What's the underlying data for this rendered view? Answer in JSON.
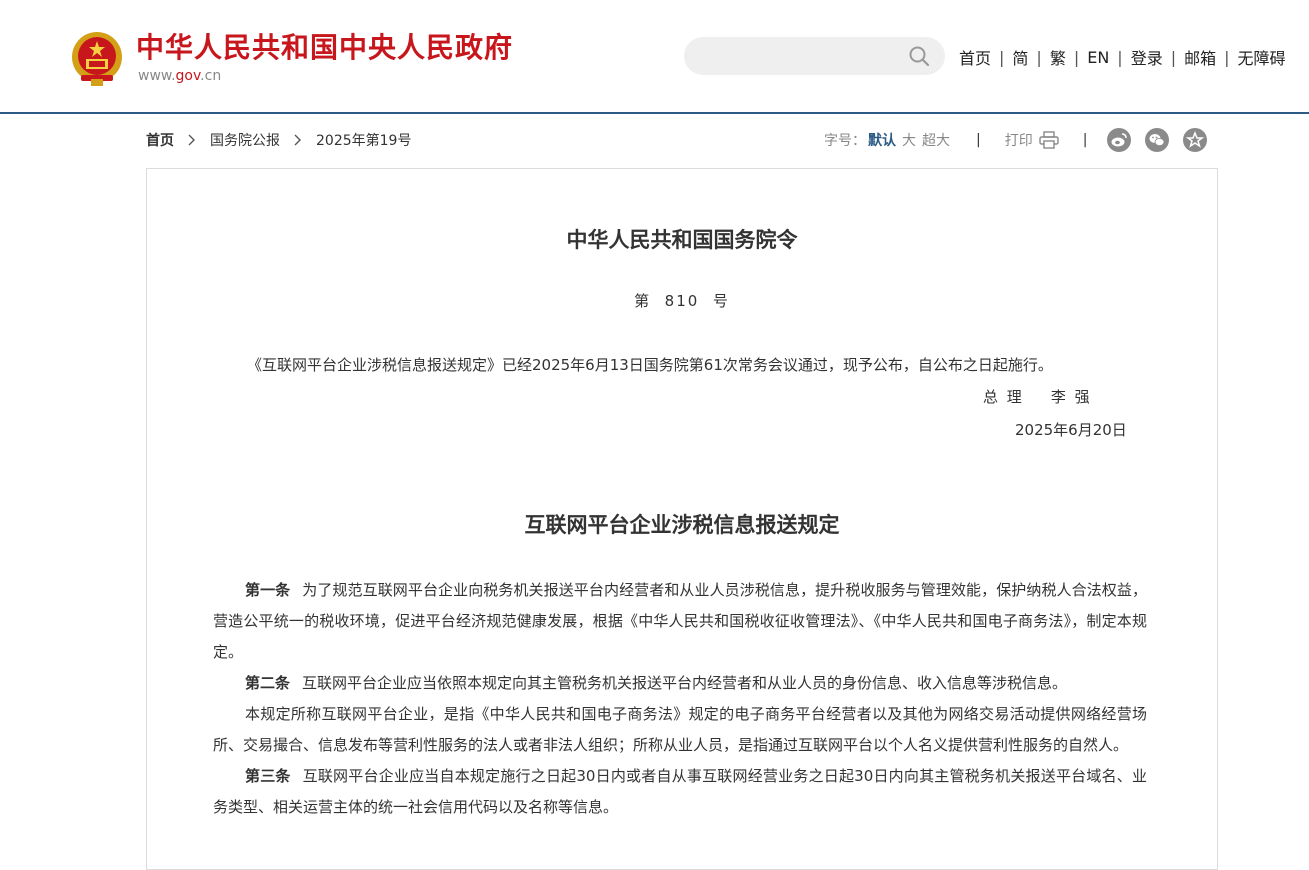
{
  "header": {
    "site_title": "中华人民共和国中央人民政府",
    "domain_prefix": "www.",
    "domain_highlight": "gov",
    "domain_suffix": ".cn",
    "search": {
      "placeholder": ""
    },
    "nav": [
      "首页",
      "简",
      "繁",
      "EN",
      "登录",
      "邮箱",
      "无障碍"
    ],
    "nav_separator": "|"
  },
  "breadcrumb": {
    "items": [
      "首页",
      "国务院公报",
      "2025年第19号"
    ]
  },
  "toolbar": {
    "font_size_label": "字号：",
    "font_sizes": [
      "默认",
      "大",
      "超大"
    ],
    "active_font_size": "默认",
    "separator": "|",
    "print_label": "打印",
    "share_icons": [
      "weibo-icon",
      "wechat-icon",
      "favorite-icon"
    ]
  },
  "article": {
    "order_title": "中华人民共和国国务院令",
    "order_number": "第  810  号",
    "order_text": "《互联网平台企业涉税信息报送规定》已经2025年6月13日国务院第61次常务会议通过，现予公布，自公布之日起施行。",
    "signatory_role": "总 理    李 强",
    "sign_date": "2025年6月20日",
    "regulation_title": "互联网平台企业涉税信息报送规定",
    "paragraphs": [
      {
        "article": "第一条",
        "text": "为了规范互联网平台企业向税务机关报送平台内经营者和从业人员涉税信息，提升税收服务与管理效能，保护纳税人合法权益，营造公平统一的税收环境，促进平台经济规范健康发展，根据《中华人民共和国税收征收管理法》、《中华人民共和国电子商务法》，制定本规定。"
      },
      {
        "article": "第二条",
        "text": "互联网平台企业应当依照本规定向其主管税务机关报送平台内经营者和从业人员的身份信息、收入信息等涉税信息。"
      },
      {
        "article": "",
        "text": "本规定所称互联网平台企业，是指《中华人民共和国电子商务法》规定的电子商务平台经营者以及其他为网络交易活动提供网络经营场所、交易撮合、信息发布等营利性服务的法人或者非法人组织；所称从业人员，是指通过互联网平台以个人名义提供营利性服务的自然人。"
      },
      {
        "article": "第三条",
        "text": "互联网平台企业应当自本规定施行之日起30日内或者自从事互联网经营业务之日起30日内向其主管税务机关报送平台域名、业务类型、相关运营主体的统一社会信用代码以及名称等信息。"
      }
    ]
  },
  "colors": {
    "brand_red": "#c8161d",
    "accent_blue": "#2b5a85",
    "panel_border": "#dcdcdc"
  }
}
